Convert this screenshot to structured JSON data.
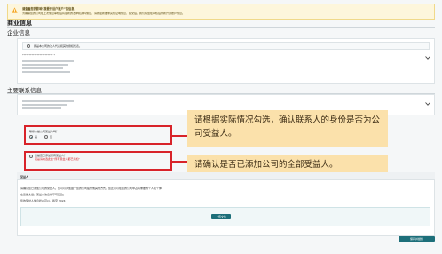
{
  "notice": {
    "title": "请查看您的影响“我要开设户账户”的信息",
    "body": "为确保您的公司在上次信息审核后有最新的法律和资料信息，请按最新要求完成证明信息，提交后，我们将会在审核后重新开通账户信息。"
  },
  "business_info": {
    "title": "商业信息"
  },
  "enterprise_info": {
    "title": "企业信息",
    "radio_label": "我是本公司的法人代表和其他授权代表。",
    "field_value": "*********************** *"
  },
  "primary_contact": {
    "title": "主要联系信息"
  },
  "beneficiary_question": {
    "label": "联系人是公司受益人吗？",
    "options": [
      "是",
      "否"
    ],
    "selected": 0
  },
  "confirm_section": {
    "line1": "您是否已添加所有受益人？",
    "line2": "若是请勾选此处“所有受益人都已添加”"
  },
  "callouts": {
    "callout1": "请根据实际情况勾选，确认联系人的身份是否为公司受益人。",
    "callout2": "请确认是否已添加公司的全部受益人。"
  },
  "lower_panel": {
    "header": "受益人",
    "text1": "请确认您已添加公司的受益人。您可以添加由于您的公司股份或其他方式，您还可以在您的公司中占有重要的个人和个体。",
    "text2": "在您提交后，受益人信息将不可更改。",
    "text3": "您的受益人信息状态可以，截至 2024",
    "upload_button": "上传文件",
    "submit_button": "保存并继续"
  },
  "colors": {
    "accent": "#1d6f7a",
    "callout_bg": "#fbe1ab",
    "highlight": "#d8232a",
    "notice_bg": "#fdf6dc"
  }
}
